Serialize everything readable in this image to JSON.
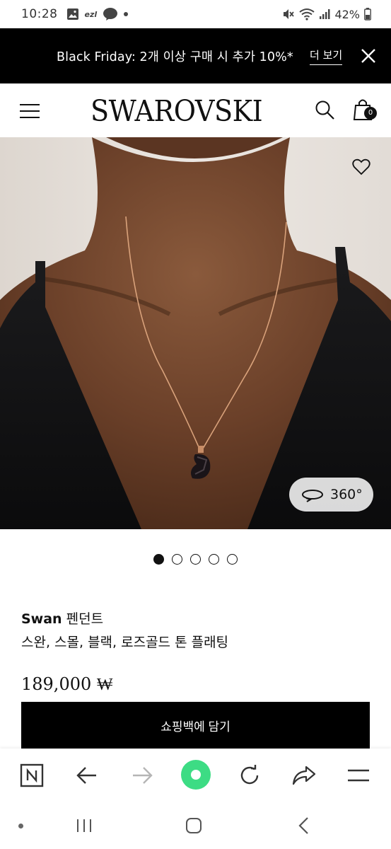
{
  "status_bar": {
    "time": "10:28",
    "battery": "42%",
    "icons": [
      "gallery-icon",
      "ezl-icon",
      "talk-icon",
      "dot-icon",
      "mute-icon",
      "wifi-icon",
      "signal-icon",
      "battery-icon"
    ],
    "ezl_label": "ezl",
    "talk_label": "TALK"
  },
  "promo": {
    "text": "Black Friday: 2개 이상 구매 시 추가 10%*",
    "link": "더 보기"
  },
  "header": {
    "logo": "SWAROVSKI",
    "bag_count": "0"
  },
  "gallery": {
    "badge_360": "360°",
    "dots_total": 5,
    "active_index": 0
  },
  "product": {
    "name_bold": "Swan",
    "name_rest": " 펜던트",
    "description": "스완, 스몰, 블랙, 로즈골드 톤 플래팅",
    "price": "189,000 ₩",
    "add_to_cart": "쇼핑백에 담기"
  },
  "colors": {
    "brand_black": "#000000",
    "browser_green": "#3ddc84",
    "text_primary": "#111111"
  }
}
